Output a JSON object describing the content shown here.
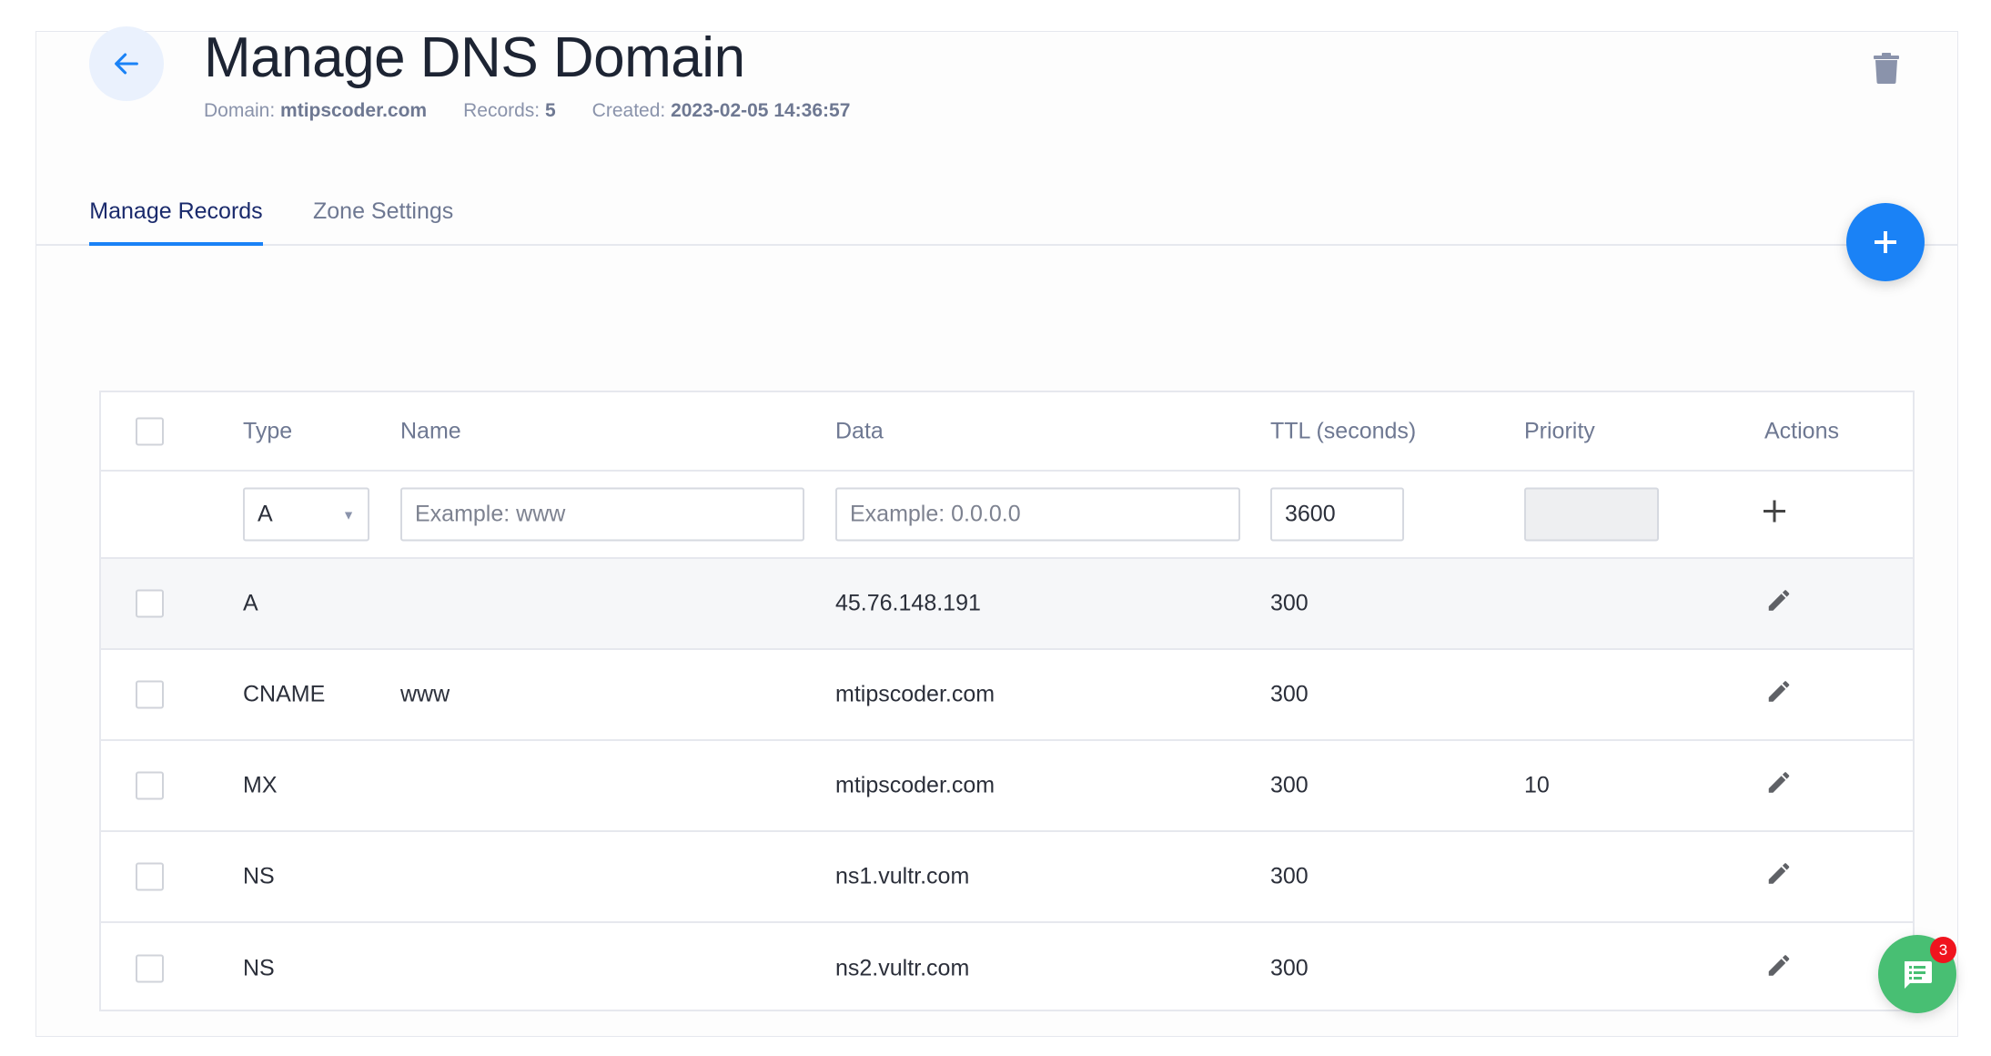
{
  "header": {
    "title": "Manage DNS Domain",
    "domain_label": "Domain:",
    "domain": "mtipscoder.com",
    "records_label": "Records:",
    "records": "5",
    "created_label": "Created:",
    "created": "2023-02-05 14:36:57"
  },
  "tabs": [
    {
      "label": "Manage Records",
      "active": true
    },
    {
      "label": "Zone Settings",
      "active": false
    }
  ],
  "table": {
    "headers": {
      "type": "Type",
      "name": "Name",
      "data": "Data",
      "ttl": "TTL (seconds)",
      "priority": "Priority",
      "actions": "Actions"
    },
    "new_record": {
      "type": "A",
      "name_placeholder": "Example: www",
      "data_placeholder": "Example: 0.0.0.0",
      "ttl": "3600"
    },
    "rows": [
      {
        "type": "A",
        "name": "",
        "data": "45.76.148.191",
        "ttl": "300",
        "priority": ""
      },
      {
        "type": "CNAME",
        "name": "www",
        "data": "mtipscoder.com",
        "ttl": "300",
        "priority": ""
      },
      {
        "type": "MX",
        "name": "",
        "data": "mtipscoder.com",
        "ttl": "300",
        "priority": "10"
      },
      {
        "type": "NS",
        "name": "",
        "data": "ns1.vultr.com",
        "ttl": "300",
        "priority": ""
      },
      {
        "type": "NS",
        "name": "",
        "data": "ns2.vultr.com",
        "ttl": "300",
        "priority": ""
      }
    ]
  },
  "chat": {
    "badge": "3"
  },
  "colors": {
    "accent": "#1a82f6",
    "chat": "#48bf73",
    "badge": "#f0141e"
  }
}
